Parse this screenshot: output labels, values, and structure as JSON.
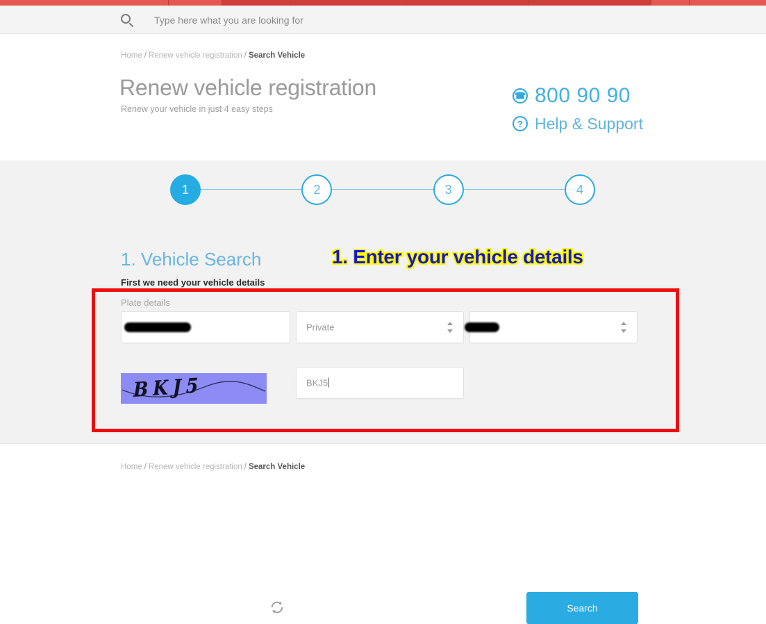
{
  "topbar": {
    "color": "#d9453f",
    "segments": [
      22,
      7,
      9,
      15,
      16,
      16,
      5,
      10
    ]
  },
  "search": {
    "placeholder": "Type here what you are looking for",
    "value": "",
    "icon": "search-icon"
  },
  "breadcrumb": {
    "home": "Home",
    "parent": "Renew vehicle registration",
    "current": "Search Vehicle",
    "separator": "/"
  },
  "hero": {
    "title": "Renew vehicle registration",
    "subtitle": "Renew your vehicle in just 4 easy steps",
    "phone": {
      "icon": "phone-icon",
      "glyph": "✆",
      "number": "800 90 90",
      "color": "#41b0e4"
    },
    "help": {
      "icon": "question-mark-icon",
      "glyph": "?",
      "label": "Help & Support",
      "color": "#5fb3de"
    }
  },
  "stepper": {
    "active_index": 0,
    "steps": [
      {
        "number": "1",
        "state": "active"
      },
      {
        "number": "2",
        "state": "inactive"
      },
      {
        "number": "3",
        "state": "inactive"
      },
      {
        "number": "4",
        "state": "inactive"
      }
    ],
    "active_color": "#25ace3",
    "inactive_color": "#ffffff"
  },
  "section": {
    "title": "1. Vehicle Search",
    "subtitle": "First we need your vehicle details",
    "callout": "1. Enter your vehicle details",
    "callout_text_color": "#1717c8",
    "callout_outline_color": "#ffff00",
    "annotation_box_color": "#ee0d0d"
  },
  "form": {
    "plate_label": "Plate details",
    "plate_number": {
      "value": "",
      "redacted": true
    },
    "plate_category": {
      "value": "Private",
      "options": [
        "Private"
      ]
    },
    "plate_code": {
      "value": "",
      "redacted": true
    },
    "captcha": {
      "image_text": "BKJ5",
      "background": "#8c8cf4",
      "refresh_icon": "refresh-icon"
    },
    "captcha_input": {
      "value": "BKJ5",
      "placeholder": ""
    },
    "search_button": {
      "label": "Search",
      "color": "#2aabe2"
    }
  }
}
